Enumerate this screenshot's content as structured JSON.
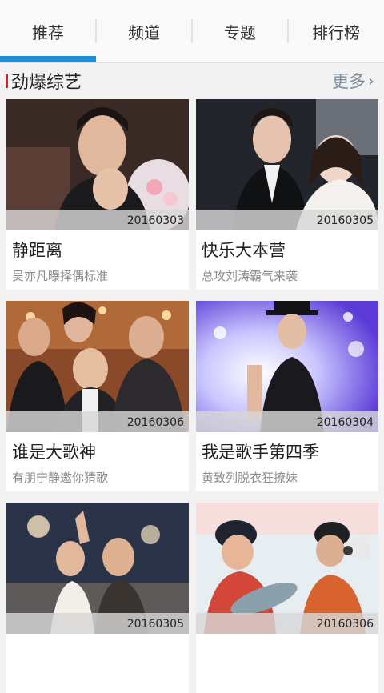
{
  "tabs": [
    {
      "label": "推荐"
    },
    {
      "label": "频道"
    },
    {
      "label": "专题"
    },
    {
      "label": "排行榜"
    }
  ],
  "section": {
    "title": "劲爆综艺",
    "more_label": "更多",
    "accent_color": "#e21f26"
  },
  "active_tab_color": "#1e90d6",
  "cards": [
    {
      "date": "20160303",
      "title": "静距离",
      "subtitle": "吴亦凡曝择偶标准"
    },
    {
      "date": "20160305",
      "title": "快乐大本营",
      "subtitle": "总攻刘涛霸气来袭"
    },
    {
      "date": "20160306",
      "title": "谁是大歌神",
      "subtitle": "有朋宁静邀你猜歌"
    },
    {
      "date": "20160304",
      "title": "我是歌手第四季",
      "subtitle": "黄致列脱衣狂撩妹"
    },
    {
      "date": "20160305",
      "title": "",
      "subtitle": ""
    },
    {
      "date": "20160306",
      "title": "",
      "subtitle": ""
    }
  ]
}
